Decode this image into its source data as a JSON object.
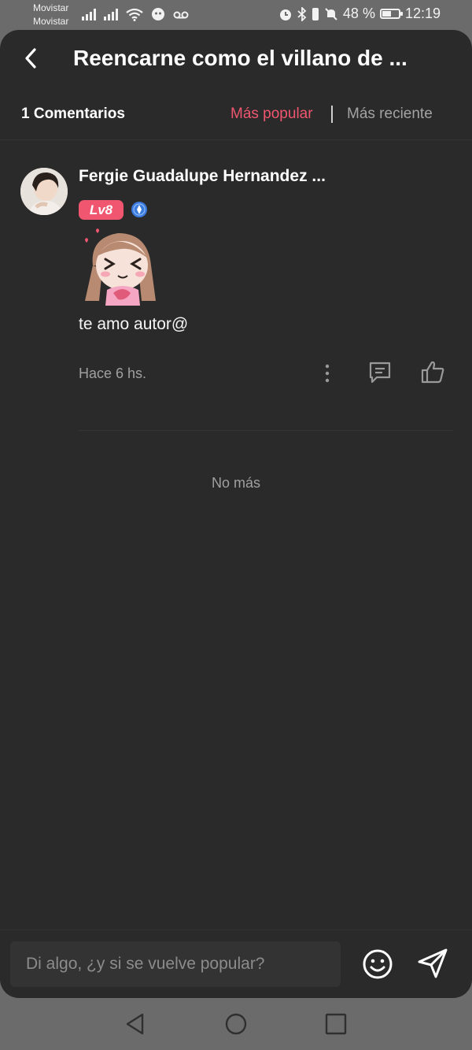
{
  "status_bar": {
    "carrier_1": "Movistar",
    "carrier_2": "Movistar",
    "battery": "48 %",
    "time": "12:19"
  },
  "header": {
    "title": "Reencarne como el villano de ..."
  },
  "comments_bar": {
    "count_label": "1 Comentarios",
    "tab_popular": "Más popular",
    "tab_recent": "Más reciente"
  },
  "comments": [
    {
      "user": "Fergie Guadalupe Hernandez ...",
      "level": "Lv8",
      "text": "te amo autor@",
      "time": "Hace 6 hs."
    }
  ],
  "no_more": "No más",
  "input": {
    "placeholder": "Di algo, ¿y si se vuelve popular?"
  },
  "colors": {
    "accent": "#f0566f",
    "background": "#2a2a2a",
    "muted_text": "#a0a0a0"
  },
  "icons": [
    "back-arrow-icon",
    "more-options-icon",
    "reply-icon",
    "like-icon",
    "emoji-icon",
    "send-icon",
    "nav-back-icon",
    "nav-home-icon",
    "nav-recents-icon"
  ]
}
